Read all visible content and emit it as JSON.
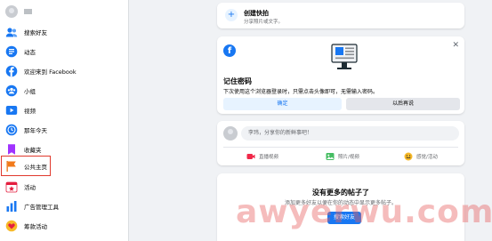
{
  "sidebar": {
    "items": [
      {
        "label": "搜索好友"
      },
      {
        "label": "动态"
      },
      {
        "label": "欢迎来到 Facebook"
      },
      {
        "label": "小组"
      },
      {
        "label": "视频"
      },
      {
        "label": "那年今天"
      },
      {
        "label": "收藏夹"
      },
      {
        "label": "公共主页"
      },
      {
        "label": "活动"
      },
      {
        "label": "广告管理工具"
      },
      {
        "label": "筹款活动"
      }
    ]
  },
  "create_story": {
    "title": "创建快拍",
    "subtitle": "分享照片或文字。",
    "plus": "+"
  },
  "password_card": {
    "title": "记住密码",
    "description": "下次使用这个浏览器登录时，只需点击头像即可，无需输入密码。",
    "ok_label": "确定",
    "later_label": "以后再说",
    "close_glyph": "✕",
    "logo_letter": "f"
  },
  "composer": {
    "placeholder": "李玮，分享你的新鲜事吧！",
    "actions": [
      {
        "label": "直播视频",
        "color": "#f02849"
      },
      {
        "label": "照片/视频",
        "color": "#45bd62"
      },
      {
        "label": "感觉/活动",
        "color": "#f7b928"
      }
    ]
  },
  "empty_feed": {
    "title": "没有更多的帖子了",
    "description": "添加更多好友以便在你的动态中显示更多帖子。",
    "button_label": "搜索好友"
  },
  "watermark": {
    "text": "awyerwu.com"
  },
  "colors": {
    "brand": "#1877f2",
    "highlight_border": "#e0392d",
    "page_bg": "#f0f2f5"
  }
}
